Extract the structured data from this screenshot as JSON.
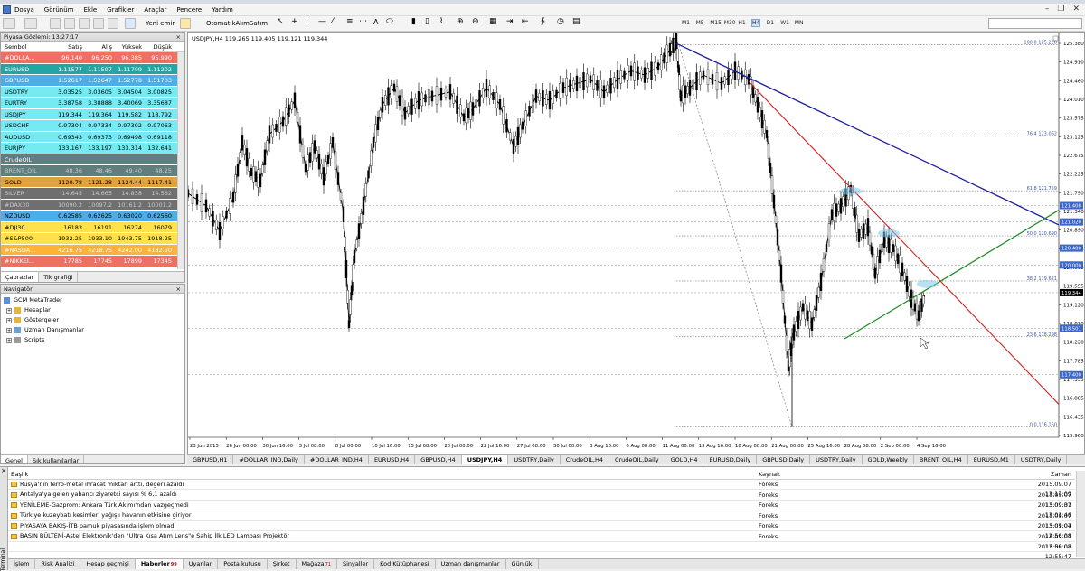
{
  "menu": [
    "Dosya",
    "Görünüm",
    "Ekle",
    "Grafikler",
    "Araçlar",
    "Pencere",
    "Yardım"
  ],
  "toolbar": {
    "new_order": "Yeni emir",
    "auto_trading": "OtomatikAlımSatım",
    "timeframes": [
      "M1",
      "M5",
      "M15",
      "M30",
      "H1",
      "H4",
      "D1",
      "W1",
      "MN"
    ],
    "active_timeframe": "H4"
  },
  "market_watch": {
    "title": "Piyasa Gözlemi: 13:27:17",
    "columns": [
      "Sembol",
      "Satış",
      "Alış",
      "Yüksek",
      "Düşük"
    ],
    "rows": [
      {
        "symbol": "#DOLLA...",
        "bid": "96.140",
        "ask": "96.250",
        "high": "96.385",
        "low": "95.990",
        "bg": "#f07060",
        "fg": "#fff"
      },
      {
        "symbol": "EURUSD",
        "bid": "1.11577",
        "ask": "1.11597",
        "high": "1.11709",
        "low": "1.11202",
        "bg": "#21a6a3",
        "fg": "#fff"
      },
      {
        "symbol": "GBPUSD",
        "bid": "1.52617",
        "ask": "1.52647",
        "high": "1.52778",
        "low": "1.51703",
        "bg": "#4baee8",
        "fg": "#fff"
      },
      {
        "symbol": "USDTRY",
        "bid": "3.03525",
        "ask": "3.03605",
        "high": "3.04504",
        "low": "3.00825",
        "bg": "#75eaf2",
        "fg": "#000"
      },
      {
        "symbol": "EURTRY",
        "bid": "3.38758",
        "ask": "3.38888",
        "high": "3.40069",
        "low": "3.35687",
        "bg": "#75eaf2",
        "fg": "#000"
      },
      {
        "symbol": "USDJPY",
        "bid": "119.344",
        "ask": "119.364",
        "high": "119.582",
        "low": "118.792",
        "bg": "#75eaf2",
        "fg": "#000"
      },
      {
        "symbol": "USDCHF",
        "bid": "0.97304",
        "ask": "0.97334",
        "high": "0.97392",
        "low": "0.97063",
        "bg": "#75eaf2",
        "fg": "#000"
      },
      {
        "symbol": "AUDUSD",
        "bid": "0.69343",
        "ask": "0.69373",
        "high": "0.69498",
        "low": "0.69118",
        "bg": "#75eaf2",
        "fg": "#000"
      },
      {
        "symbol": "EURJPY",
        "bid": "133.167",
        "ask": "133.197",
        "high": "133.314",
        "low": "132.641",
        "bg": "#75eaf2",
        "fg": "#000"
      },
      {
        "symbol": "CrudeOIL",
        "bid": "",
        "ask": "",
        "high": "",
        "low": "",
        "bg": "#5f7f7f",
        "fg": "#fff"
      },
      {
        "symbol": "BRENT_OIL",
        "bid": "48.36",
        "ask": "48.46",
        "high": "49.40",
        "low": "48.25",
        "bg": "#5f7f7f",
        "fg": "#c8c8c8"
      },
      {
        "symbol": "GOLD",
        "bid": "1120.78",
        "ask": "1121.28",
        "high": "1124.44",
        "low": "1117.41",
        "bg": "#e0a23c",
        "fg": "#000"
      },
      {
        "symbol": "SILVER",
        "bid": "14.645",
        "ask": "14.665",
        "high": "14.838",
        "low": "14.582",
        "bg": "#6f6f6f",
        "fg": "#c8c8c8"
      },
      {
        "symbol": "#DAX30",
        "bid": "10090.2",
        "ask": "10097.2",
        "high": "10161.2",
        "low": "10001.2",
        "bg": "#6f6f6f",
        "fg": "#c8c8c8"
      },
      {
        "symbol": "NZDUSD",
        "bid": "0.62585",
        "ask": "0.62625",
        "high": "0.63020",
        "low": "0.62560",
        "bg": "#4baee8",
        "fg": "#000"
      },
      {
        "symbol": "#DJI30",
        "bid": "16183",
        "ask": "16191",
        "high": "16274",
        "low": "16079",
        "bg": "#ffe14d",
        "fg": "#000"
      },
      {
        "symbol": "#S&P500",
        "bid": "1932.25",
        "ask": "1933.10",
        "high": "1943.75",
        "low": "1918.25",
        "bg": "#ffe14d",
        "fg": "#000"
      },
      {
        "symbol": "#NASDA...",
        "bid": "4216.75",
        "ask": "4218.75",
        "high": "4242.00",
        "low": "4182.50",
        "bg": "#ffb236",
        "fg": "#fff"
      },
      {
        "symbol": "#NIKKEI...",
        "bid": "17785",
        "ask": "17745",
        "high": "17899",
        "low": "17345",
        "bg": "#f07060",
        "fg": "#fff"
      }
    ],
    "tabs": [
      "Çaprazlar",
      "Tik grafiği"
    ]
  },
  "navigator": {
    "title": "Navigatör",
    "items": [
      "GCM MetaTrader",
      "Hesaplar",
      "Göstergeler",
      "Uzman Danışmanlar",
      "Scripts"
    ],
    "tabs": [
      "Genel",
      "Sık kullanılanlar"
    ]
  },
  "chart": {
    "header": "USDJPY,H4  119.265 119.405 119.121 119.344",
    "price_ticks": [
      "125.380",
      "124.910",
      "124.460",
      "124.010",
      "123.575",
      "123.125",
      "122.675",
      "122.225",
      "121.790",
      "121.340",
      "120.890",
      "120.455",
      "120.005",
      "119.555",
      "119.120",
      "118.670",
      "118.220",
      "117.785",
      "117.335",
      "116.885",
      "116.435",
      "115.960"
    ],
    "fib_labels": [
      {
        "label": "100.0 125.220",
        "price": 125.22
      },
      {
        "label": "76.4 123.062",
        "price": 123.062
      },
      {
        "label": "61.8 121.759",
        "price": 121.759
      },
      {
        "label": "50.0 120.690",
        "price": 120.69
      },
      {
        "label": "38.2 119.621",
        "price": 119.621
      },
      {
        "label": "23.6 118.298",
        "price": 118.298
      },
      {
        "label": "0.0 116.160",
        "price": 116.16
      }
    ],
    "price_boxes": [
      {
        "label": "121.408",
        "price": 121.408,
        "color": "#3c67c8"
      },
      {
        "label": "121.020",
        "price": 121.02,
        "color": "#3c67c8"
      },
      {
        "label": "120.000",
        "price": 120.0,
        "color": "#3c67c8"
      },
      {
        "label": "120.400",
        "price": 120.4,
        "color": "#3c67c8"
      },
      {
        "label": "119.344",
        "price": 119.344,
        "color": "#000"
      },
      {
        "label": "118.501",
        "price": 118.501,
        "color": "#3c67c8"
      },
      {
        "label": "117.400",
        "price": 117.4,
        "color": "#3c67c8"
      }
    ],
    "time_ticks": [
      "23 Jun 2015",
      "26 Jun 00:00",
      "30 Jun 16:00",
      "3 Jul 08:00",
      "8 Jul 00:00",
      "10 Jul 16:00",
      "15 Jul 08:00",
      "20 Jul 00:00",
      "22 Jul 16:00",
      "27 Jul 08:00",
      "30 Jul 00:00",
      "3 Aug 16:00",
      "6 Aug 08:00",
      "11 Aug 00:00",
      "13 Aug 16:00",
      "18 Aug 08:00",
      "21 Aug 00:00",
      "25 Aug 16:00",
      "28 Aug 08:00",
      "2 Sep 00:00",
      "4 Sep 16:00"
    ]
  },
  "chart_tabs": [
    "GBPUSD,H1",
    "#DOLLAR_IND,Daily",
    "#DOLLAR_IND,H4",
    "EURUSD,H4",
    "GBPUSD,H4",
    "USDJPY,H4",
    "USDTRY,Daily",
    "CrudeOIL,H4",
    "CrudeOIL,Daily",
    "GOLD,H4",
    "EURUSD,Daily",
    "GBPUSD,Daily",
    "USDTRY,Daily",
    "GOLD,Weekly",
    "BRENT_OIL,H4",
    "EURUSD,M1",
    "USDTRY,Daily"
  ],
  "active_chart_tab": "USDJPY,H4",
  "terminal": {
    "side_label": "Terminal",
    "columns": [
      "Başlık",
      "Kaynak",
      "Zaman"
    ],
    "news": [
      {
        "title": "Rusya'nın ferro-metal ihracat miktarı arttı, değeri azaldı",
        "source": "Foreks",
        "time": "2015.09.07 13:17:09"
      },
      {
        "title": "Antalya'ya gelen yabancı ziyaretçi sayısı % 6,1 azaldı",
        "source": "Foreks",
        "time": "2015.09.07 13:09:31"
      },
      {
        "title": "YENİLEME-Gazprom: Ankara Türk Akımı'ndan vazgeçmedi",
        "source": "Foreks",
        "time": "2015.09.07 13:01:46"
      },
      {
        "title": "Türkiye kuzeybatı kesimleri yağışlı havanın etkisine giriyor",
        "source": "Foreks",
        "time": "2015.09.07 13:01:04"
      },
      {
        "title": "PİYASAYA BAKIŞ-İTB pamuk piyasasında işlem olmadı",
        "source": "Foreks",
        "time": "2015.09.07 12:56:08"
      },
      {
        "title": "BASIN BÜLTENİ-Astel Elektronik'den \"Ultra Kısa Atım Lens\"e Sahip İlk LED Lambası Projektör",
        "source": "Foreks",
        "time": "2015.09.07 12:56:08"
      },
      {
        "title": "",
        "source": "",
        "time": "2015.09.07 12:55:47"
      }
    ],
    "tabs": [
      {
        "label": "İşlem"
      },
      {
        "label": "Risk Analizi"
      },
      {
        "label": "Hesap geçmişi"
      },
      {
        "label": "Haberler",
        "count": "99"
      },
      {
        "label": "Uyarılar"
      },
      {
        "label": "Posta kutusu"
      },
      {
        "label": "Şirket"
      },
      {
        "label": "Mağaza",
        "count": "71"
      },
      {
        "label": "Sinyaller"
      },
      {
        "label": "Kod Kütüphanesi"
      },
      {
        "label": "Uzman danışmanlar"
      },
      {
        "label": "Günlük"
      }
    ],
    "active_tab": "Haberler"
  }
}
